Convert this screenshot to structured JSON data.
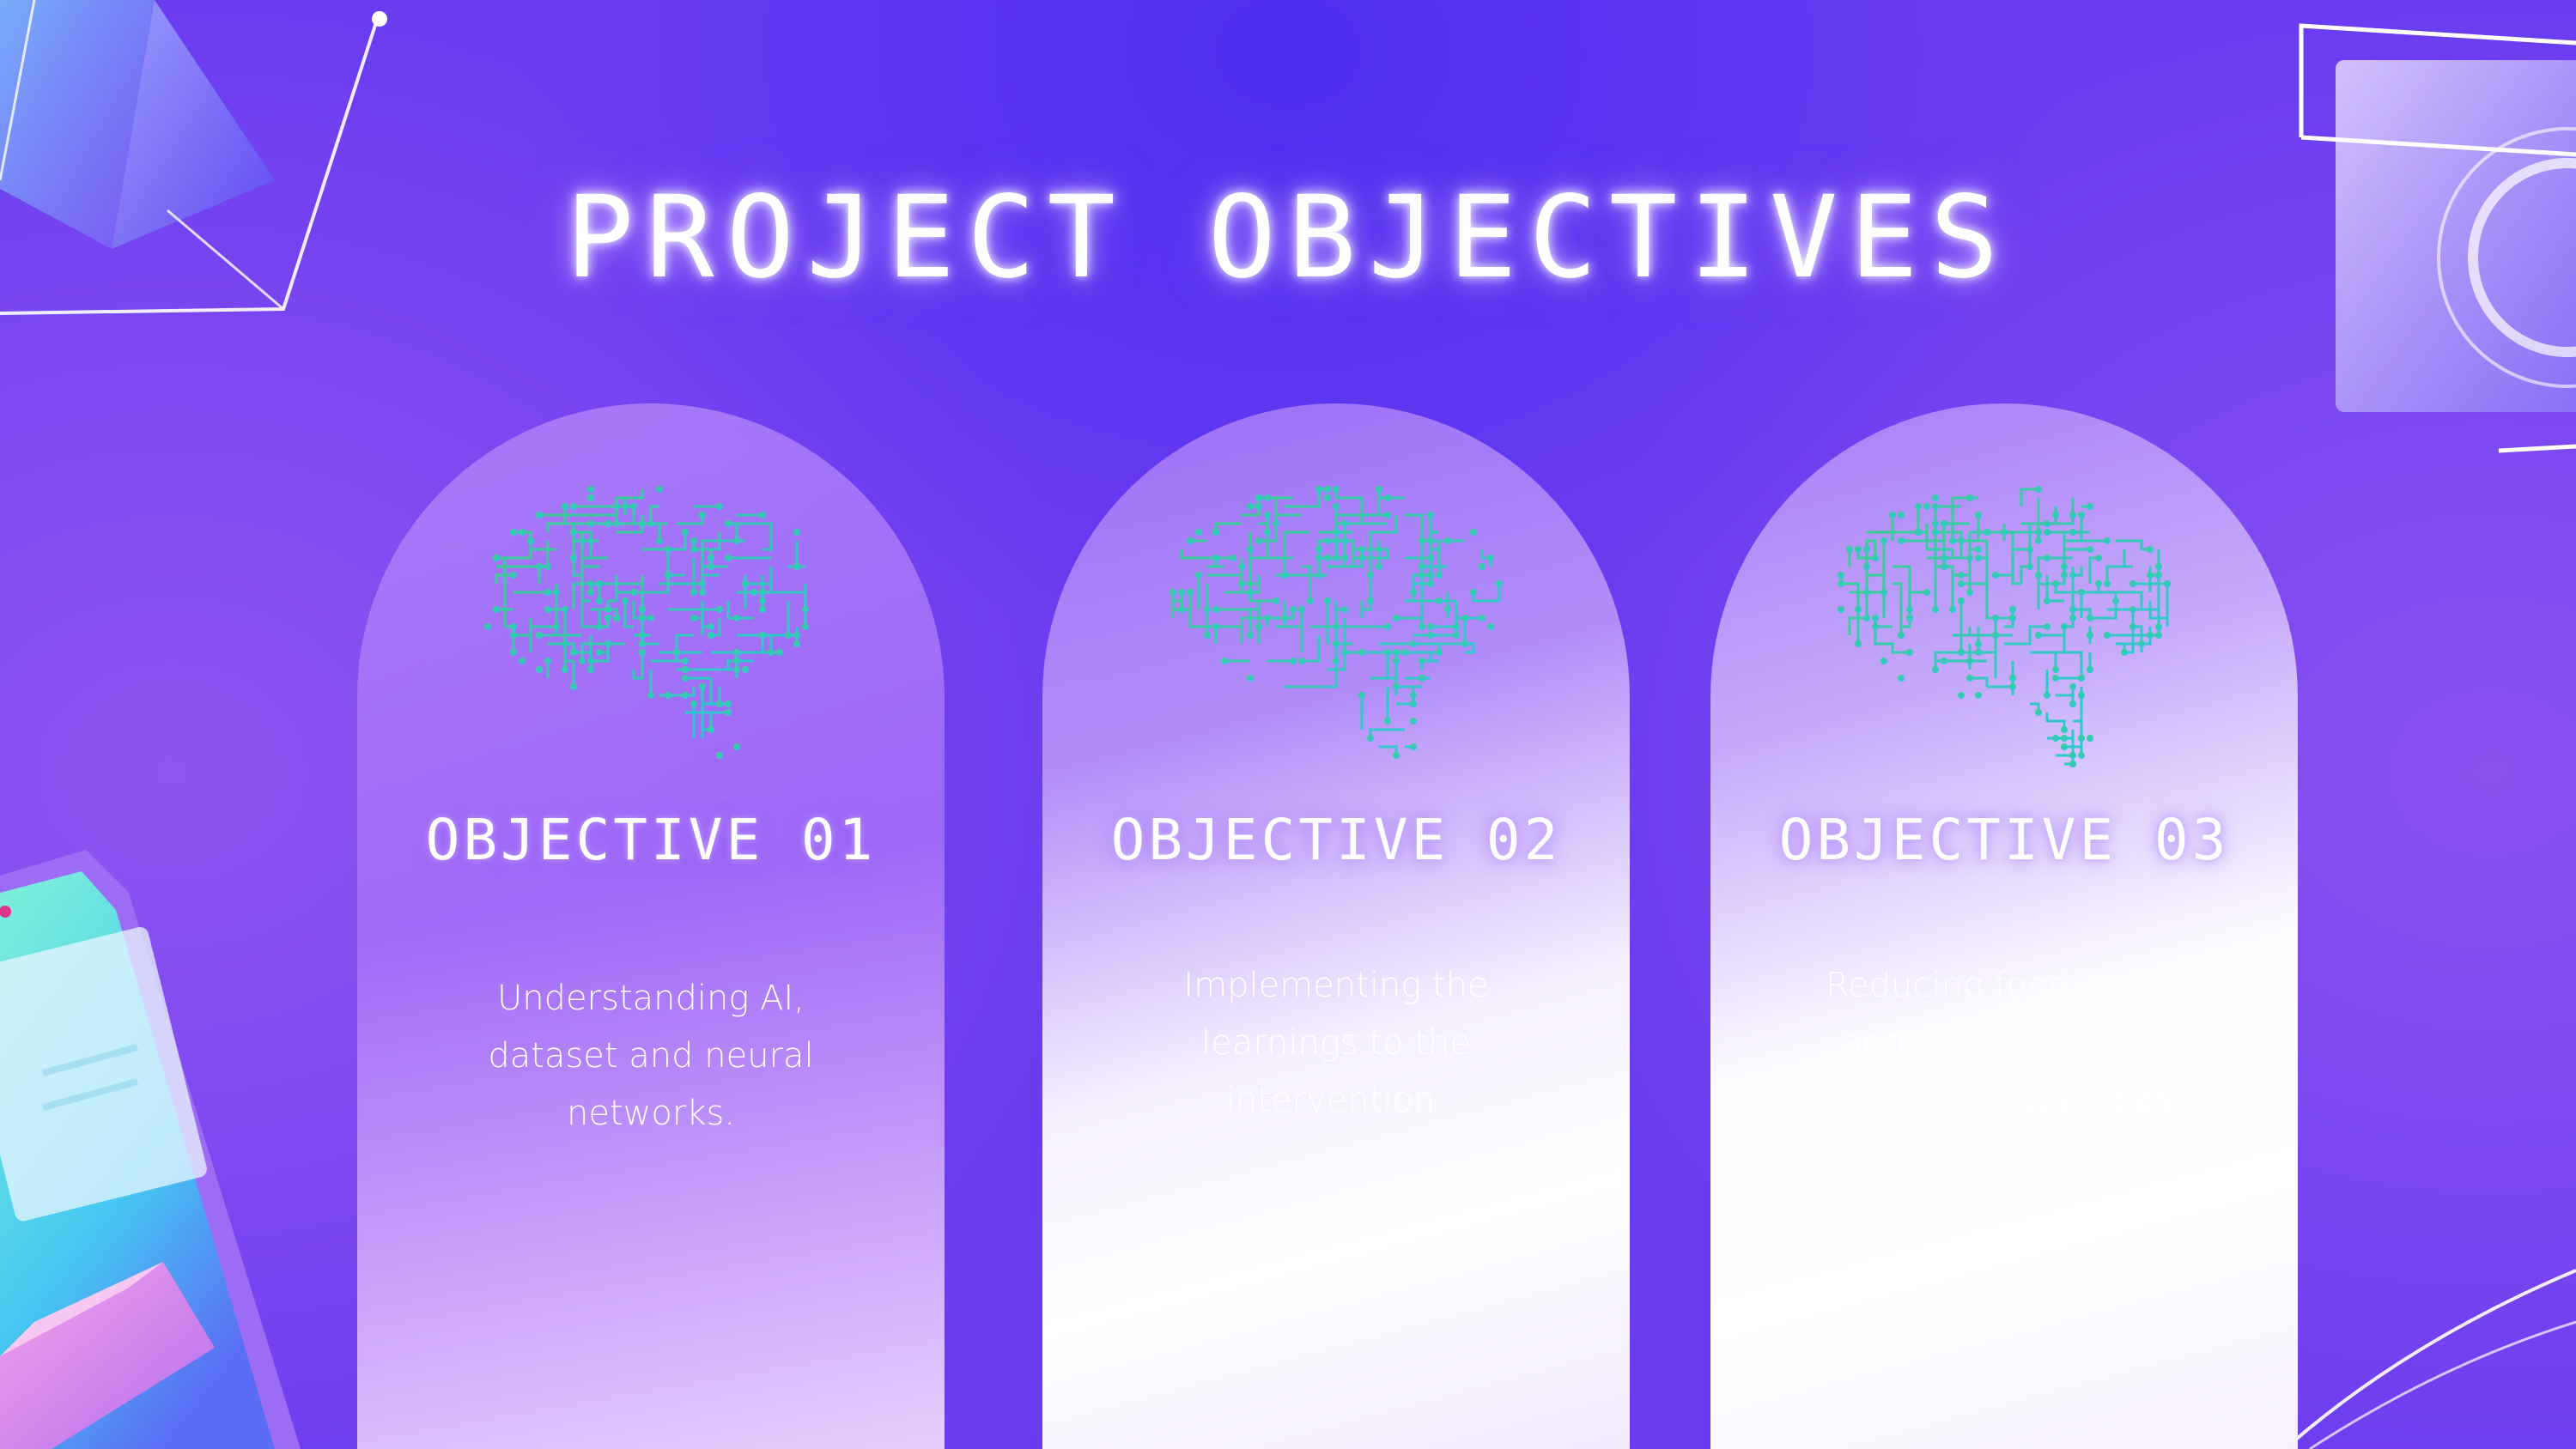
{
  "slide": {
    "title": "PROJECT OBJECTIVES"
  },
  "objectives": [
    {
      "title": "OBJECTIVE 01",
      "description": "Understanding AI, dataset and neural networks."
    },
    {
      "title": "OBJECTIVE 02",
      "description": "Implementing the learnings to the intervention."
    },
    {
      "title": "OBJECTIVE 03",
      "description": "Reducing food waste and experimenting the new possibilities."
    }
  ],
  "colors": {
    "background": "#6a3cf1",
    "brain_circuit_start": "#3ad08a",
    "brain_circuit_end": "#2cc6e0",
    "title_glow": "#cdb4ff"
  },
  "icons": [
    "brain-circuit-icon",
    "prism-shape",
    "phone-illustration",
    "camera-frame-illustration"
  ]
}
